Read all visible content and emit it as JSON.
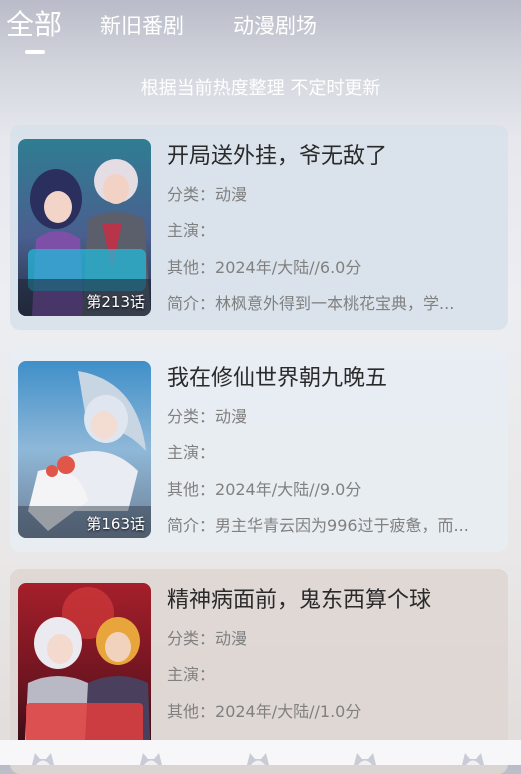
{
  "tabs": [
    {
      "label": "全部",
      "active": true
    },
    {
      "label": "新旧番剧",
      "active": false
    },
    {
      "label": "动漫剧场",
      "active": false
    }
  ],
  "subtitle": "根据当前热度整理 不定时更新",
  "field_labels": {
    "category": "分类：",
    "cast": "主演：",
    "other": "其他：",
    "intro": "简介："
  },
  "items": [
    {
      "title": "开局送外挂，爷无敌了",
      "episode": "第213话",
      "category": "动漫",
      "cast": "",
      "other": "2024年/大陆//6.0分",
      "intro": "林枫意外得到一本桃花宝典，学..."
    },
    {
      "title": "我在修仙世界朝九晚五",
      "episode": "第163话",
      "category": "动漫",
      "cast": "",
      "other": "2024年/大陆//9.0分",
      "intro": "男主华青云因为996过于疲惫，而..."
    },
    {
      "title": "精神病面前，鬼东西算个球",
      "episode": "",
      "category": "动漫",
      "cast": "",
      "other": "2024年/大陆//1.0分",
      "intro": ""
    }
  ],
  "bottom_nav": [
    {
      "icon": "cat-ear-avatar-icon"
    },
    {
      "icon": "cat-ear-avatar-icon"
    },
    {
      "icon": "cat-ear-avatar-icon"
    },
    {
      "icon": "cat-ear-avatar-icon"
    },
    {
      "icon": "cat-ear-avatar-icon"
    }
  ],
  "colors": {
    "accent_text": "#ffffff",
    "title_text": "#2a2a2a",
    "meta_text": "#808080"
  }
}
